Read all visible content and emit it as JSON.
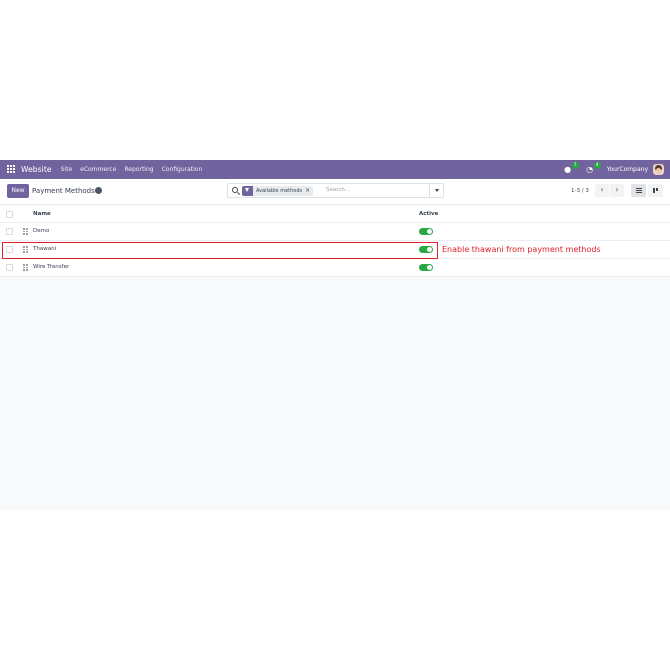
{
  "navbar": {
    "brand": "Website",
    "menu": [
      "Site",
      "eCommerce",
      "Reporting",
      "Configuration"
    ],
    "messages_count": "7",
    "activities_count": "4",
    "company": "YourCompany"
  },
  "control": {
    "new_label": "New",
    "title": "Payment Methods",
    "search": {
      "facet": "Available methods",
      "placeholder": "Search..."
    },
    "pager": "1-3 / 3"
  },
  "table": {
    "columns": [
      "Name",
      "Active"
    ],
    "rows": [
      {
        "name": "Demo",
        "active": true
      },
      {
        "name": "Thawani",
        "active": true
      },
      {
        "name": "Wire Transfer",
        "active": true
      }
    ]
  },
  "annotation": {
    "text": "Enable thawani from payment methods",
    "color": "#e0202a"
  },
  "colors": {
    "brand": "#71639e",
    "toggle_on": "#28a745"
  }
}
